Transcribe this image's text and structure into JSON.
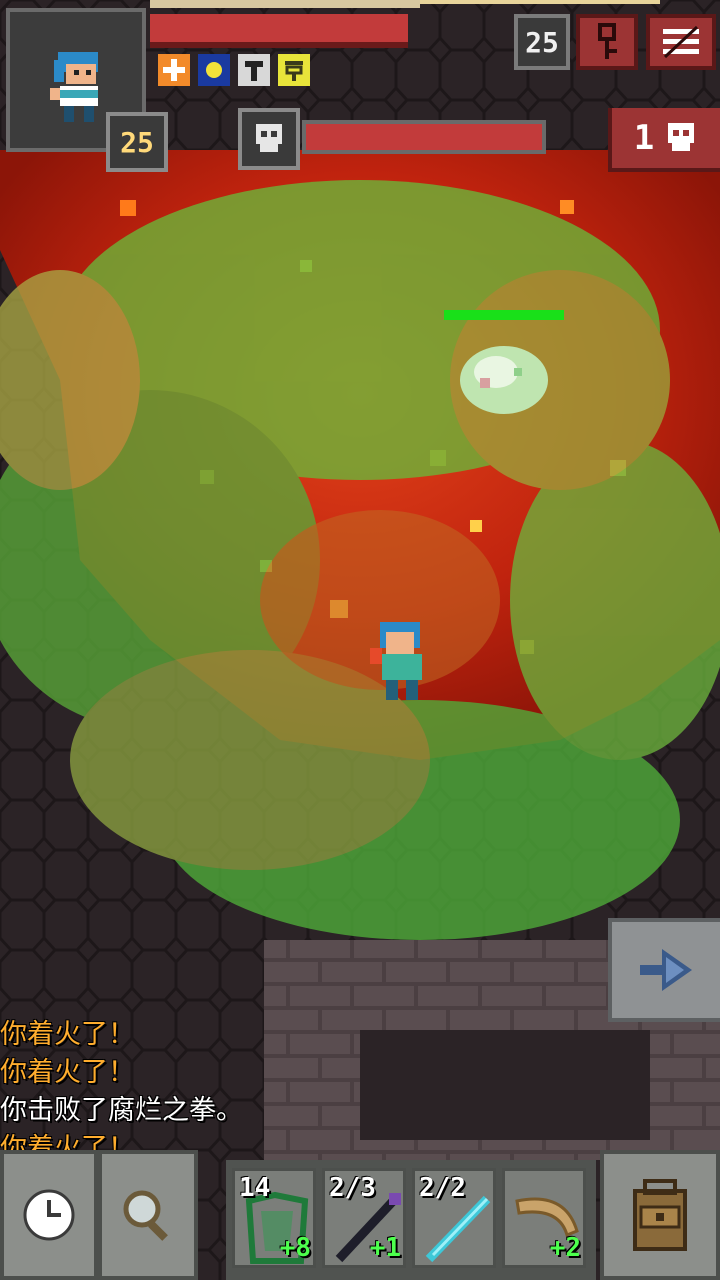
{
  "hud": {
    "hero_level": "25",
    "depth": "25",
    "enemy_count": "1",
    "buffs": [
      {
        "icon": "fire-ward-icon",
        "color": "#f28a2a"
      },
      {
        "icon": "light-orb-icon",
        "color": "#f2e23a"
      },
      {
        "icon": "hammer-icon",
        "color": "#dcdcdc"
      },
      {
        "icon": "rune-icon",
        "color": "#e8e43a"
      }
    ]
  },
  "log": [
    {
      "text": "你着火了！",
      "type": "warn"
    },
    {
      "text": "你着火了！",
      "type": "warn"
    },
    {
      "text": "你击败了腐烂之拳。",
      "type": "info"
    },
    {
      "text": "你着火了！",
      "type": "warn"
    }
  ],
  "quickslots": [
    {
      "count": "14",
      "bonus": "+8",
      "icon": "green-armor-icon"
    },
    {
      "count": "2/3",
      "bonus": "+1",
      "icon": "dark-wand-icon"
    },
    {
      "count": "2/2",
      "bonus": "",
      "icon": "frost-wand-icon"
    },
    {
      "count": "",
      "bonus": "+2",
      "icon": "boomerang-icon"
    }
  ],
  "colors": {
    "lava": "#c8240f",
    "toxic_gas": "#4fbf3a",
    "hp_red": "#c23b3b",
    "log_warning": "#ffad2e"
  }
}
